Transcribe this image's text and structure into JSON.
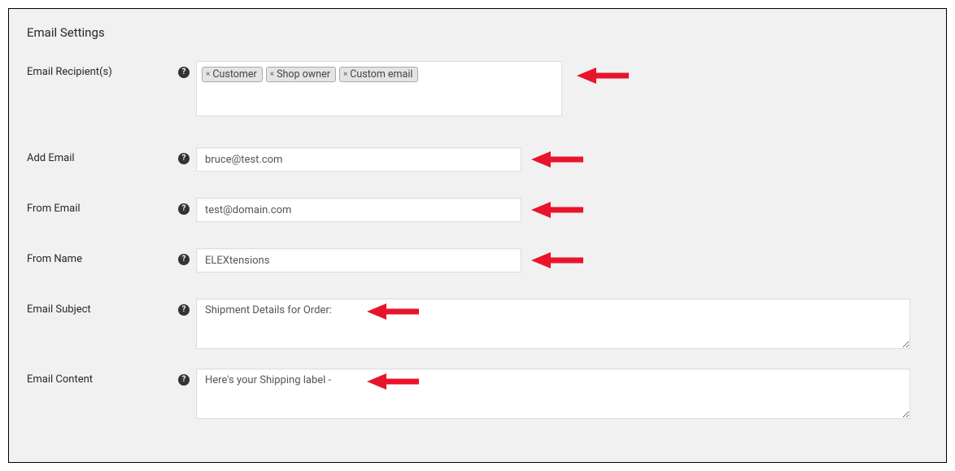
{
  "section_title": "Email Settings",
  "fields": {
    "recipients": {
      "label": "Email Recipient(s)",
      "tags": [
        "Customer",
        "Shop owner",
        "Custom email"
      ]
    },
    "add_email": {
      "label": "Add Email",
      "value": "bruce@test.com"
    },
    "from_email": {
      "label": "From Email",
      "value": "test@domain.com"
    },
    "from_name": {
      "label": "From Name",
      "value": "ELEXtensions"
    },
    "subject": {
      "label": "Email Subject",
      "value": "Shipment Details for Order:"
    },
    "content": {
      "label": "Email Content",
      "value": "Here's your Shipping label -"
    }
  },
  "icons": {
    "help": "?"
  }
}
